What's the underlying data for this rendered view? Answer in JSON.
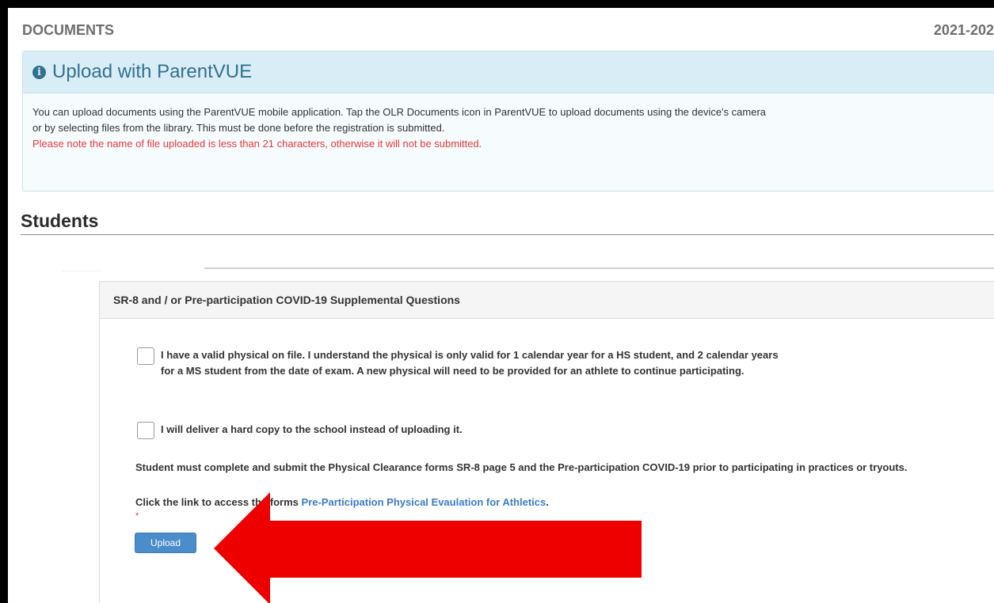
{
  "header": {
    "title": "DOCUMENTS",
    "year": "2021-202"
  },
  "info_panel": {
    "heading": "Upload with ParentVUE",
    "line1": "You can upload documents using the ParentVUE mobile application. Tap the OLR Documents icon in ParentVUE to upload documents using the device's camera",
    "line2": "or by selecting files from the library. This must be done before the registration is submitted.",
    "warning": "Please note the name of file uploaded is less than 21 characters, otherwise it will not be submitted."
  },
  "students": {
    "title": "Students"
  },
  "card": {
    "title": "SR-8 and / or Pre-participation COVID-19 Supplemental Questions",
    "checkbox1": {
      "label": "I have a valid physical on file. I understand the physical is only valid for 1 calendar year for a HS student, and 2 calendar years for a MS student from the date of exam. A new physical will need to be provided for an athlete to continue participating."
    },
    "checkbox2": {
      "label": "I will deliver a hard copy to the school instead of uploading it."
    },
    "instructions": "Student must complete and submit the Physical Clearance forms SR-8 page 5 and the Pre-participation COVID-19 prior to participating in practices or tryouts.",
    "link_prefix": "Click the link to access the forms ",
    "link_text": "Pre-Participation Physical Evaulation for Athletics",
    "link_suffix": ".",
    "required_mark": "*",
    "upload_label": "Upload"
  },
  "colors": {
    "info_heading_bg": "#d9edf7",
    "info_text": "#31708f",
    "warning": "#e8383d",
    "link": "#3b7cc4",
    "button": "#4b8ccb",
    "annotation_arrow": "#ee0000"
  },
  "icons": {
    "info": "info-circle-icon",
    "annotation": "red-arrow-left-icon"
  }
}
